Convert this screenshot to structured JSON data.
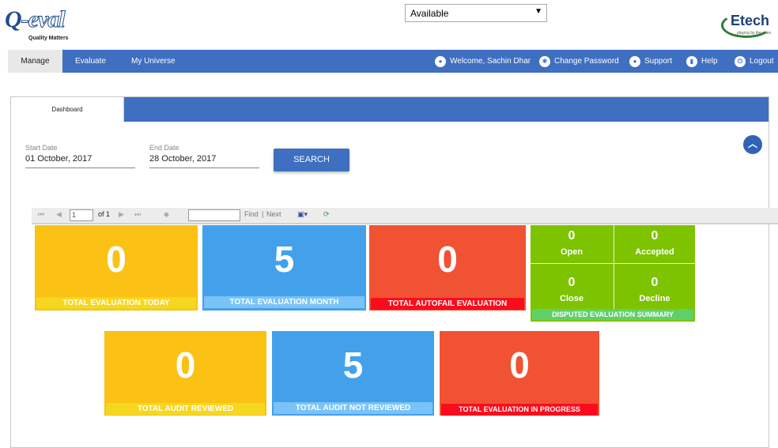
{
  "brand": {
    "logo_text": "Q-eval",
    "tagline": "Quality Matters",
    "partner_logo": "Etech",
    "partner_tagline": "playing by the rules"
  },
  "status_select": {
    "value": "Available"
  },
  "nav": {
    "items": [
      {
        "label": "Manage",
        "active": true
      },
      {
        "label": "Evaluate",
        "active": false
      },
      {
        "label": "My Universe",
        "active": false
      }
    ],
    "welcome": "Welcome, Sachin Dhar",
    "change_password": "Change Password",
    "support": "Support",
    "help": "Help",
    "logout": "Logout"
  },
  "panel": {
    "tab": "Dashboard",
    "start_date_label": "Start Date",
    "start_date_value": "01 October, 2017",
    "end_date_label": "End Date",
    "end_date_value": "28 October, 2017",
    "search_label": "SEARCH"
  },
  "report_toolbar": {
    "page_value": "1",
    "of_text": "of 1",
    "find_label": "Find",
    "separator": "|",
    "next_label": "Next"
  },
  "tiles": {
    "eval_today": {
      "value": "0",
      "label": "TOTAL EVALUATION  TODAY",
      "color": "#fbc115",
      "caption_color": "#f6d71f"
    },
    "eval_month": {
      "value": "5",
      "label": "TOTAL EVALUATION MONTH",
      "color": "#43a1ec",
      "caption_color": "#7ac3f8"
    },
    "autofail": {
      "value": "0",
      "label": "TOTAL AUTOFAIL EVALUATION",
      "color": "#f05233",
      "caption_color": "#fb0c1c"
    },
    "audit_reviewed": {
      "value": "0",
      "label": "TOTAL AUDIT REVIEWED",
      "color": "#fbc115",
      "caption_color": "#f6d71f"
    },
    "audit_not_reviewed": {
      "value": "5",
      "label": "TOTAL AUDIT NOT REVIEWED",
      "color": "#43a1ec",
      "caption_color": "#7ac3f8"
    },
    "in_progress": {
      "value": "0",
      "label": "TOTAL EVALUATION IN PROGRESS",
      "color": "#f05233",
      "caption_color": "#fb0c1c"
    }
  },
  "disputed": {
    "title": "DISPUTED EVALUATION SUMMARY",
    "open_value": "0",
    "open_label": "Open",
    "accepted_value": "0",
    "accepted_label": "Accepted",
    "close_value": "0",
    "close_label": "Close",
    "decline_value": "0",
    "decline_label": "Decline"
  },
  "icons": {
    "welcome": "user-icon",
    "change_password": "gear-icon",
    "support": "support-icon",
    "help": "book-icon",
    "logout": "power-icon",
    "collapse": "chevron-up-icon"
  }
}
